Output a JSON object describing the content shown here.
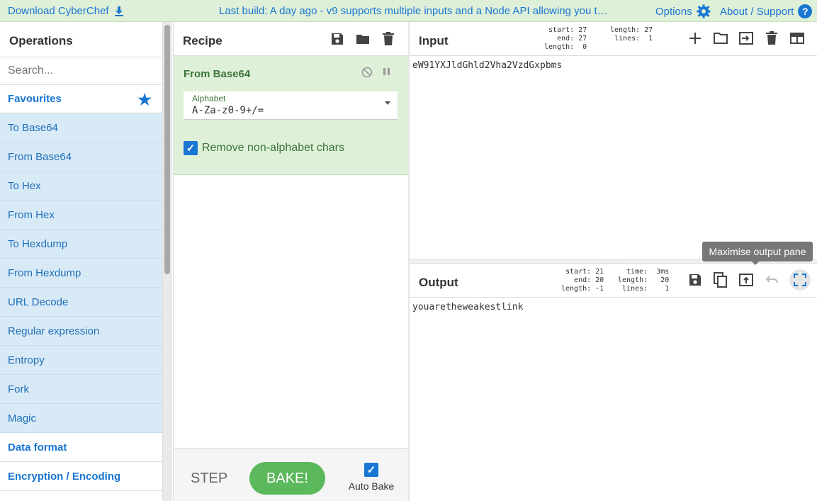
{
  "banner": {
    "download_label": "Download CyberChef",
    "notice": "Last build: A day ago - v9 supports multiple inputs and a Node API allowing you to p…",
    "options_label": "Options",
    "about_label": "About / Support"
  },
  "operations": {
    "title": "Operations",
    "search_placeholder": "Search...",
    "favourites_label": "Favourites",
    "favourites": [
      "To Base64",
      "From Base64",
      "To Hex",
      "From Hex",
      "To Hexdump",
      "From Hexdump",
      "URL Decode",
      "Regular expression",
      "Entropy",
      "Fork",
      "Magic"
    ],
    "categories": [
      "Data format",
      "Encryption / Encoding"
    ]
  },
  "recipe": {
    "title": "Recipe",
    "operation_name": "From Base64",
    "alphabet_label": "Alphabet",
    "alphabet_value": "A-Za-z0-9+/=",
    "remove_nonalpha_label": "Remove non-alphabet chars",
    "step_label": "STEP",
    "bake_label": "BAKE!",
    "autobake_label": "Auto Bake"
  },
  "input": {
    "title": "Input",
    "stats_left": "start: 27\n  end: 27\nlength:  0",
    "stats_right": "length: 27\n lines:  1",
    "text": "eW91YXJldGhld2Vha2VzdGxpbms"
  },
  "output": {
    "title": "Output",
    "stats_left": " start: 21\n   end: 20\nlength: -1",
    "stats_right": "  time:  3ms\nlength:   20\n lines:    1",
    "text": "youaretheweakestlink"
  },
  "tooltip": "Maximise output pane",
  "colors": {
    "accent": "#1976d2",
    "banner_bg": "#dff0d8",
    "favourite_bg": "#d9eaf7",
    "bake_green": "#5cb85c"
  }
}
